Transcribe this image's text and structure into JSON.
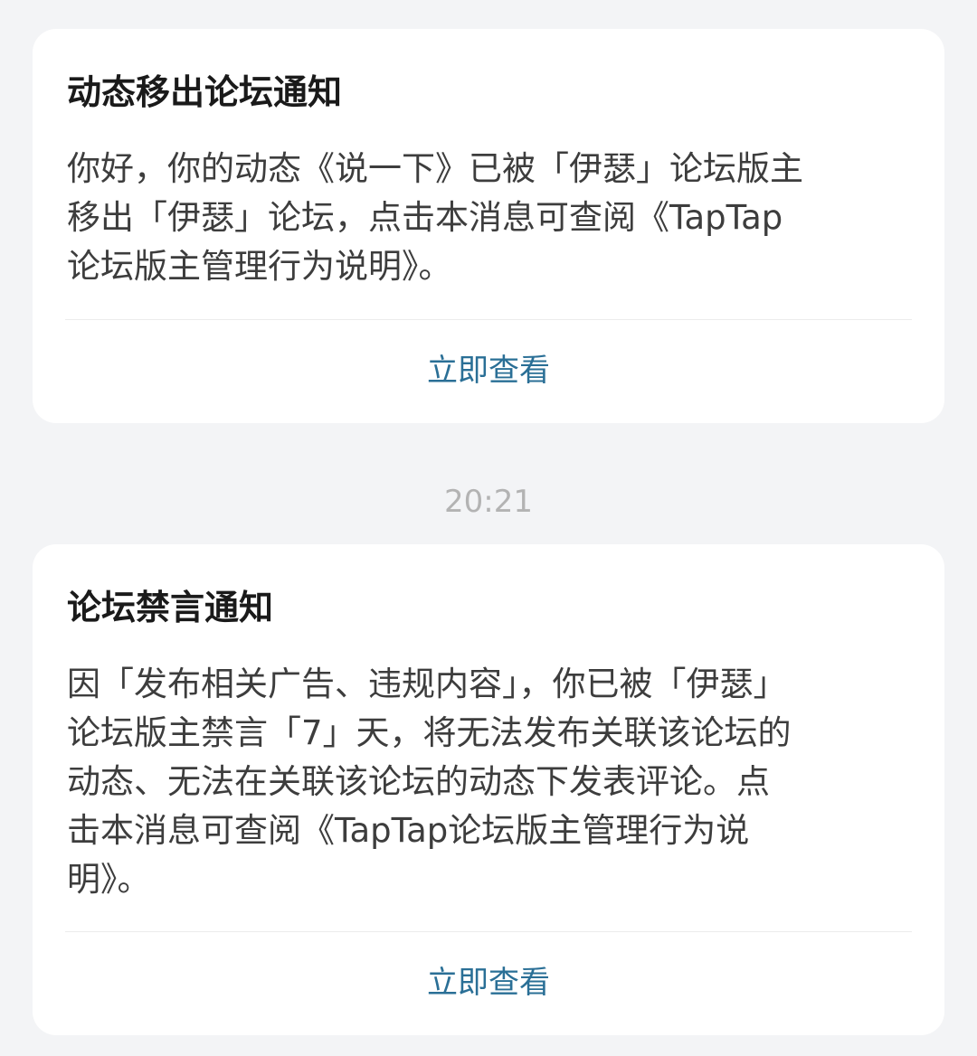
{
  "notifications": [
    {
      "title": "动态移出论坛通知",
      "body_lines": [
        "你好，你的动态《说一下》已被「伊瑟」论坛版主",
        "移出「伊瑟」论坛，点击本消息可查阅《TapTap",
        "论坛版主管理行为说明》。"
      ],
      "action_label": "立即查看"
    },
    {
      "title": "论坛禁言通知",
      "body_lines": [
        "因「发布相关广告、违规内容」，你已被「伊瑟」",
        "论坛版主禁言「7」天，将无法发布关联该论坛的",
        "动态、无法在关联该论坛的动态下发表评论。点",
        "击本消息可查阅《TapTap论坛版主管理行为说",
        "明》。"
      ],
      "action_label": "立即查看"
    }
  ],
  "timestamp": "20:21",
  "colors": {
    "background": "#f3f4f6",
    "card": "#ffffff",
    "title": "#1a1a1a",
    "body": "#3d3d3d",
    "action": "#2a6f96",
    "timestamp": "#b3b3b3"
  }
}
